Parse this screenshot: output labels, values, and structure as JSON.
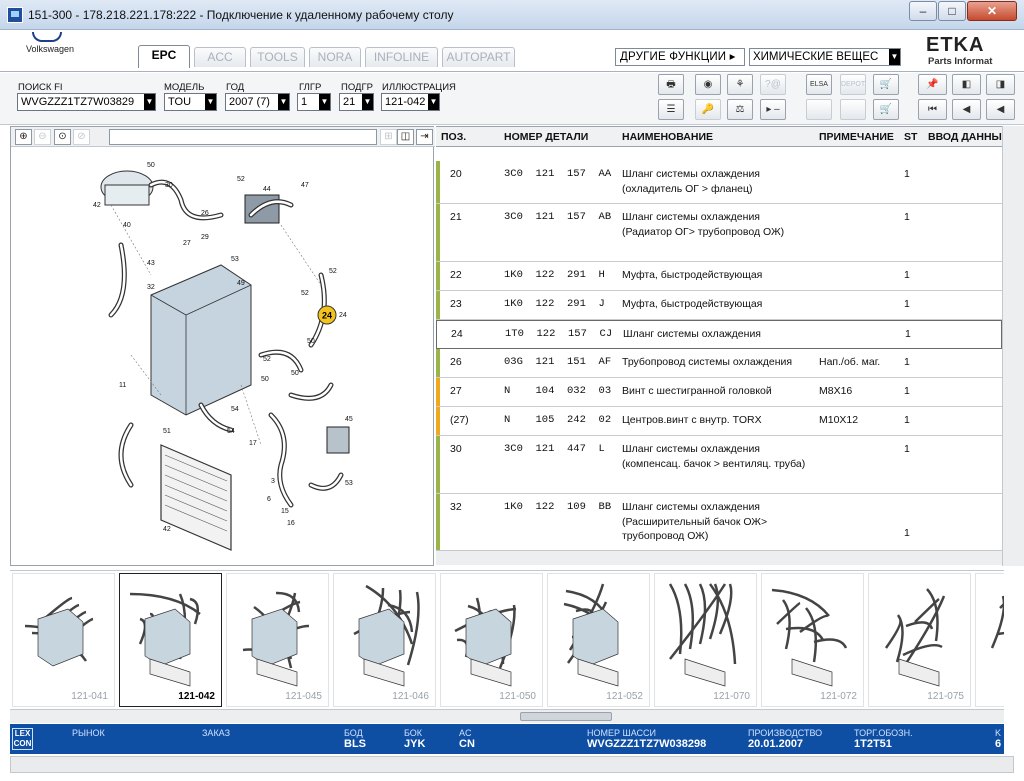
{
  "window": {
    "title": "151-300 - 178.218.221.178:222 - Подключение к удаленному рабочему столу",
    "min": "–",
    "max": "□",
    "close": "✕"
  },
  "header": {
    "brand": "Volkswagen",
    "tabs": [
      "EPC",
      "ACC",
      "TOOLS",
      "NORA",
      "INFOLINE",
      "AUTOPART"
    ],
    "other_functions": "ДРУГИЕ ФУНКЦИИ ▸",
    "chem_select": "ХИМИЧЕСКИЕ ВЕЩЕС",
    "etka": "ETKA",
    "etka_sub": "Parts Informat"
  },
  "filters": {
    "search_label": "ПОИСК FI",
    "search_value": "WVGZZZ1TZ7W03829",
    "model_label": "МОДЕЛЬ",
    "model_value": "TOU",
    "year_label": "ГОД",
    "year_value": "2007 (7)",
    "hgr_label": "ГЛГР",
    "hgr_value": "1",
    "sgr_label": "ПОДГР",
    "sgr_value": "21",
    "illu_label": "ИЛЛЮСТРАЦИЯ",
    "illu_value": "121-042"
  },
  "toolbar": {
    "row1": [
      "🖶",
      "◉",
      "⚘",
      "?@",
      "ELSA",
      "DEPOT",
      "🛒"
    ],
    "row2": [
      "☰",
      "🔑",
      "⚖",
      "▸ –",
      "",
      "",
      "🛒"
    ],
    "nav1": [
      "📌",
      "◧",
      "◨"
    ],
    "nav2": [
      "⏮",
      "◀",
      "◀"
    ]
  },
  "zoom": {
    "buttons": [
      "⊕",
      "⊖",
      "⊙",
      "⊘"
    ],
    "right_buttons": [
      "⊞",
      "◫",
      "⇥"
    ]
  },
  "table": {
    "headers": {
      "pos": "ПОЗ.",
      "part": "НОМЕР ДЕТАЛИ",
      "name": "НАИМЕНОВАНИЕ",
      "note": "ПРИМЕЧАНИЕ",
      "st": "ST",
      "input": "ВВОД ДАННЫ"
    },
    "rows": [
      {
        "pos": "20",
        "part": "3C0  121  157  AA",
        "name": "Шланг системы охлаждения (охладитель ОГ > фланец)",
        "note": "",
        "st": "1"
      },
      {
        "pos": "21",
        "part": "3C0  121  157  AB",
        "name": "Шланг системы охлаждения (Радиатор ОГ> трубопровод ОЖ)",
        "note": "",
        "st": "1"
      },
      {
        "pos": "22",
        "part": "1K0  122  291  H",
        "name": "Муфта, быстродействующая",
        "note": "",
        "st": "1"
      },
      {
        "pos": "23",
        "part": "1K0  122  291  J",
        "name": "Муфта, быстродействующая",
        "note": "",
        "st": "1"
      },
      {
        "pos": "24",
        "part": "1T0  122  157  CJ",
        "name": "Шланг системы охлаждения",
        "note": "",
        "st": "1"
      },
      {
        "pos": "26",
        "part": "03G  121  151  AF",
        "name": "Трубопровод системы охлаждения",
        "note": "Нап./об. маг.",
        "st": "1"
      },
      {
        "pos": "27",
        "part": "N    104  032  03",
        "name": "Винт с шестигранной головкой",
        "note": "M8X16",
        "st": "1"
      },
      {
        "pos": "(27)",
        "part": "N    105  242  02",
        "name": "Центров.винт с внутр. TORX",
        "note": "M10X12",
        "st": "1"
      },
      {
        "pos": "30",
        "part": "3C0  121  447  L",
        "name": "Шланг системы охлаждения (компенсац. бачок > вентиляц. труба)",
        "note": "",
        "st": "1"
      },
      {
        "pos": "32",
        "part": "1K0  122  109  BB",
        "name": "Шланг системы охлаждения (Расширительный бачок ОЖ> трубопровод ОЖ)",
        "note": "",
        "st": "1"
      }
    ]
  },
  "thumbnails": [
    {
      "label": "121-041"
    },
    {
      "label": "121-042"
    },
    {
      "label": "121-045"
    },
    {
      "label": "121-046"
    },
    {
      "label": "121-050"
    },
    {
      "label": "121-052"
    },
    {
      "label": "121-070"
    },
    {
      "label": "121-072"
    },
    {
      "label": "121-075"
    },
    {
      "label": ""
    }
  ],
  "status": {
    "lexcon": "LEX CON",
    "market_label": "РЫНОК",
    "order_label": "ЗАКАЗ",
    "bod_label": "БОД",
    "bod_value": "BLS",
    "bok_label": "БОК",
    "bok_value": "JYK",
    "ac_label": "AC",
    "ac_value": "CN",
    "chassis_label": "НОМЕР ШАССИ",
    "chassis_value": "WVGZZZ1TZ7W038298",
    "prod_label": "ПРОИЗВОДСТВО",
    "prod_value": "20.01.2007",
    "trade_label": "ТОРГ.ОБОЗН.",
    "trade_value": "1T2T51",
    "extra_label": "K",
    "extra_value": "6"
  },
  "illustration": {
    "highlight_label": "24",
    "callouts": [
      "50",
      "30",
      "52",
      "44",
      "47",
      "26",
      "27",
      "29",
      "40",
      "42",
      "43",
      "32",
      "53",
      "49",
      "52",
      "24",
      "52",
      "50",
      "52",
      "50",
      "11",
      "51",
      "50",
      "45",
      "17",
      "54",
      "15",
      "16",
      "6",
      "3",
      "42",
      "53",
      "54"
    ]
  }
}
